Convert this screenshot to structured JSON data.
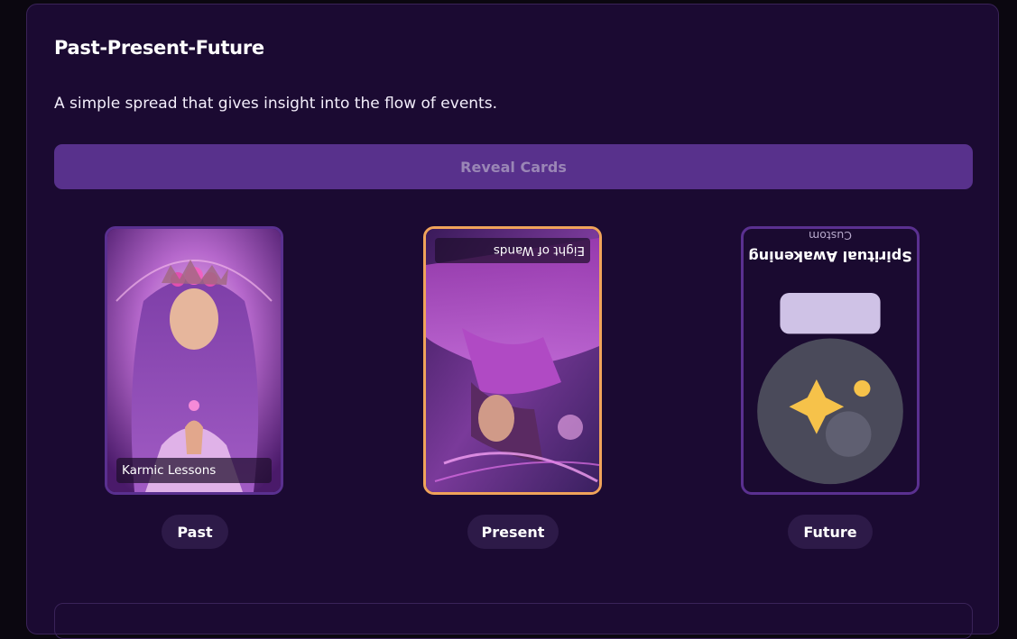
{
  "spread": {
    "title": "Past-Present-Future",
    "description": "A simple spread that gives insight into the flow of events.",
    "reveal_label": "Reveal Cards"
  },
  "cards": [
    {
      "position": "Past",
      "name": "Karmic Lessons",
      "reversed": false
    },
    {
      "position": "Present",
      "name": "Eight of Wands",
      "reversed": true
    },
    {
      "position": "Future",
      "name": "Spiritual Awakening",
      "type": "Custom",
      "reversed": true,
      "icon": "crystal-ball-icon"
    }
  ],
  "colors": {
    "panel": "#1b0a32",
    "accent": "#58318c",
    "present_border": "#f0a35a"
  }
}
